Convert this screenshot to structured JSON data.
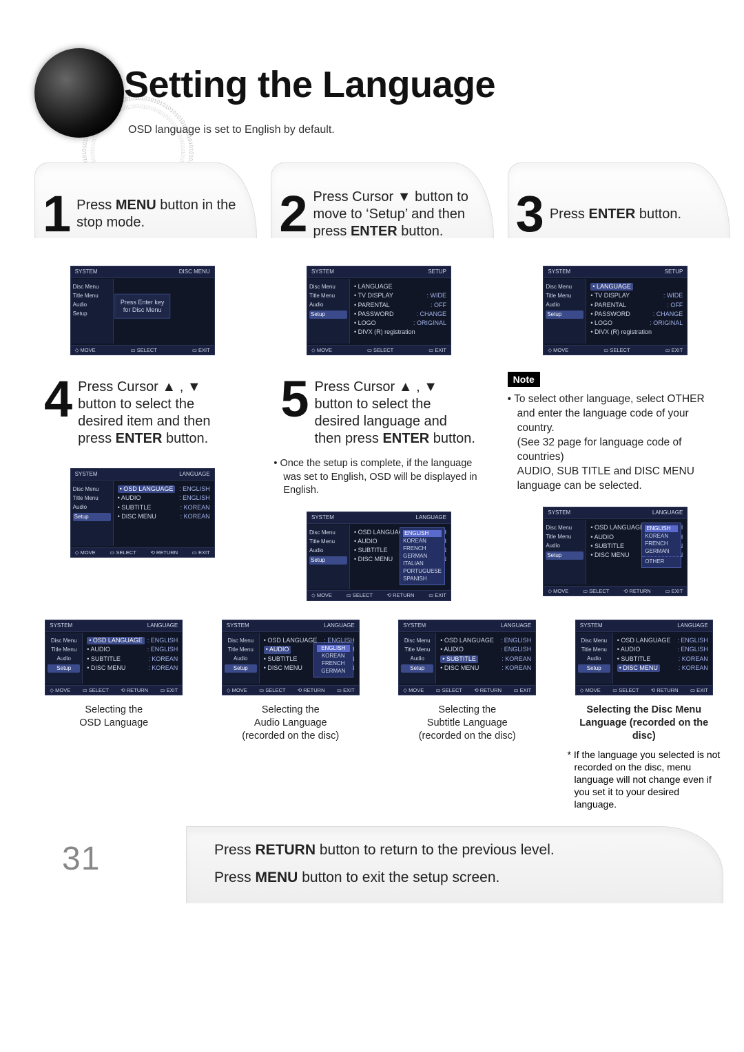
{
  "title": "Setting the Language",
  "subtitle": "OSD language is set to English by default.",
  "page_number": "31",
  "decor_binary": "01010101010101010101010101",
  "steps": [
    {
      "num": "1",
      "html": "Press <b>MENU</b> button in the stop mode."
    },
    {
      "num": "2",
      "html": "Press Cursor <span class='arrow'>▼</span> button to move to ‘Setup’ and then press <b>ENTER</b> button."
    },
    {
      "num": "3",
      "html": "Press <b>ENTER</b> button."
    },
    {
      "num": "4",
      "html": "Press Cursor <span class='arrow'>▲</span> , <span class='arrow'>▼</span> button to select the desired item and then press <b>ENTER</b> button."
    },
    {
      "num": "5",
      "html": "Press Cursor <span class='arrow'>▲</span> , <span class='arrow'>▼</span> button to select the desired language and then press <b>ENTER</b> button."
    }
  ],
  "step5_bullet": "Once the setup is complete, if the language was set to English, OSD will be displayed in English.",
  "note": {
    "label": "Note",
    "items": [
      "To select other language, select OTHER and enter the language code of your country.\n(See 32 page for language code of countries)\nAUDIO, SUB TITLE and DISC MENU language can be selected."
    ]
  },
  "osd": {
    "footer": {
      "move": "MOVE",
      "select": "SELECT",
      "return": "RETURN",
      "exit": "EXIT"
    },
    "left_items": [
      "Disc Menu",
      "Title Menu",
      "Audio",
      "Setup"
    ],
    "sys_label": "SYSTEM",
    "disc_menu_header": "DISC MENU",
    "centerbox": "Press Enter key\nfor Disc Menu",
    "setup_header": "SETUP",
    "setup_rows": [
      {
        "k": "LANGUAGE",
        "v": ""
      },
      {
        "k": "TV DISPLAY",
        "v": "WIDE"
      },
      {
        "k": "PARENTAL",
        "v": "OFF"
      },
      {
        "k": "PASSWORD",
        "v": "CHANGE"
      },
      {
        "k": "LOGO",
        "v": "ORIGINAL"
      },
      {
        "k": "DIVX (R) registration",
        "v": ""
      }
    ],
    "lang_header": "LANGUAGE",
    "lang_rows": [
      {
        "k": "OSD LANGUAGE",
        "v": "ENGLISH"
      },
      {
        "k": "AUDIO",
        "v": "ENGLISH"
      },
      {
        "k": "SUBTITLE",
        "v": "KOREAN"
      },
      {
        "k": "DISC MENU",
        "v": "KOREAN"
      }
    ],
    "osd_lang_options": [
      "ENGLISH",
      "KOREAN",
      "FRENCH",
      "GERMAN",
      "ITALIAN",
      "PORTUGUESE",
      "SPANISH"
    ],
    "subtitle_options": [
      "ENGLISH",
      "KOREAN",
      "FRENCH",
      "GERMAN",
      "OTHER"
    ],
    "audio_options": [
      "ENGLISH",
      "KOREAN",
      "FRENCH",
      "GERMAN"
    ]
  },
  "grid4": [
    {
      "highlight": "OSD LANGUAGE",
      "cap": "Selecting the\nOSD Language"
    },
    {
      "highlight": "AUDIO",
      "cap": "Selecting the\nAudio Language\n(recorded on the disc)"
    },
    {
      "highlight": "SUBTITLE",
      "cap": "Selecting the\nSubtitle Language\n(recorded on the disc)"
    },
    {
      "highlight": "DISC MENU",
      "cap_html": "<b>Selecting the Disc Menu\nLanguage (recorded on the disc)</b>"
    }
  ],
  "aster": "If the language you selected is not recorded on the disc, menu language will not change even if you set it to your desired language.",
  "footer_lines": [
    "Press <b>RETURN</b> button to return to the previous level.",
    "Press <b>MENU</b> button to exit the setup screen."
  ]
}
